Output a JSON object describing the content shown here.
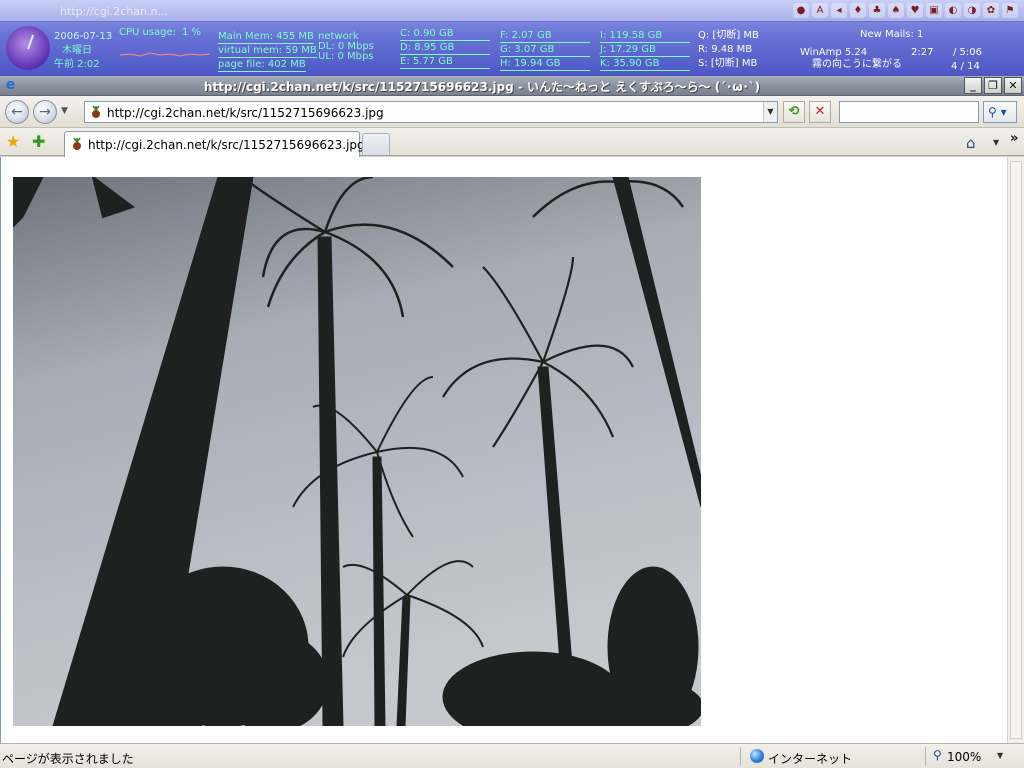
{
  "system_bar": {
    "task_url": "http://cgi.2chan.n...",
    "date": "2006-07-13",
    "weekday": "木曜日",
    "time": "午前 2:02",
    "cpu_label": "CPU usage:",
    "cpu_value": "1 %",
    "main_mem": "Main Mem: 455 MB",
    "virtual_mem": "virtual mem: 59 MB",
    "page_file": "page file: 402 MB",
    "network_label": "network",
    "network_dl": "DL: 0 Mbps",
    "network_ul": "UL: 0 Mbps",
    "drives": [
      {
        "text": "C: 0.90 GB"
      },
      {
        "text": "D: 8.95 GB"
      },
      {
        "text": "E: 5.77 GB"
      },
      {
        "text": "F: 2.07 GB"
      },
      {
        "text": "G: 3.07 GB"
      },
      {
        "text": "H: 19.94 GB"
      },
      {
        "text": "I: 119.58 GB"
      },
      {
        "text": "J: 17.29 GB"
      },
      {
        "text": "K: 35.90 GB"
      },
      {
        "text": "Q: [切断] MB"
      },
      {
        "text": "R: 9.48 MB"
      },
      {
        "text": "S: [切断] MB"
      }
    ],
    "new_mails": "New Mails: 1",
    "winamp_label": "WinAmp 5.24",
    "winamp_time": "2:27",
    "winamp_total": "/ 5:06",
    "track_title": "霧の向こうに繋がる",
    "track_pos": "4 / 14"
  },
  "window": {
    "title": "http://cgi.2chan.net/k/src/1152715696623.jpg - いんた〜ねっと えくすぷろ〜ら〜 (´･ω･`)",
    "minimize": "_",
    "maximize": "❐",
    "close": "✕"
  },
  "navigation": {
    "back_icon": "back-arrow-icon",
    "forward_icon": "forward-arrow-icon",
    "address_url": "http://cgi.2chan.net/k/src/1152715696623.jpg",
    "refresh_glyph": "⟲",
    "stop_glyph": "✕",
    "search_placeholder": "",
    "search_glyph": "⚲",
    "search_drop": "▾"
  },
  "tabs": [
    {
      "label": "http://cgi.2chan.net/k/src/1152715696623.jpg",
      "active": true
    }
  ],
  "toolbar": {
    "favorites_glyph": "★",
    "add_favorite_glyph": "✚",
    "home_glyph": "⌂",
    "more_glyph": "»"
  },
  "status_bar": {
    "message": "ページが表示されました",
    "zone": "インターネット",
    "zoom": "100%"
  },
  "colors": {
    "title_bar": "#8b93a1",
    "sysbar": "#6a74d6",
    "sysbar_text": "#7cffd0"
  }
}
